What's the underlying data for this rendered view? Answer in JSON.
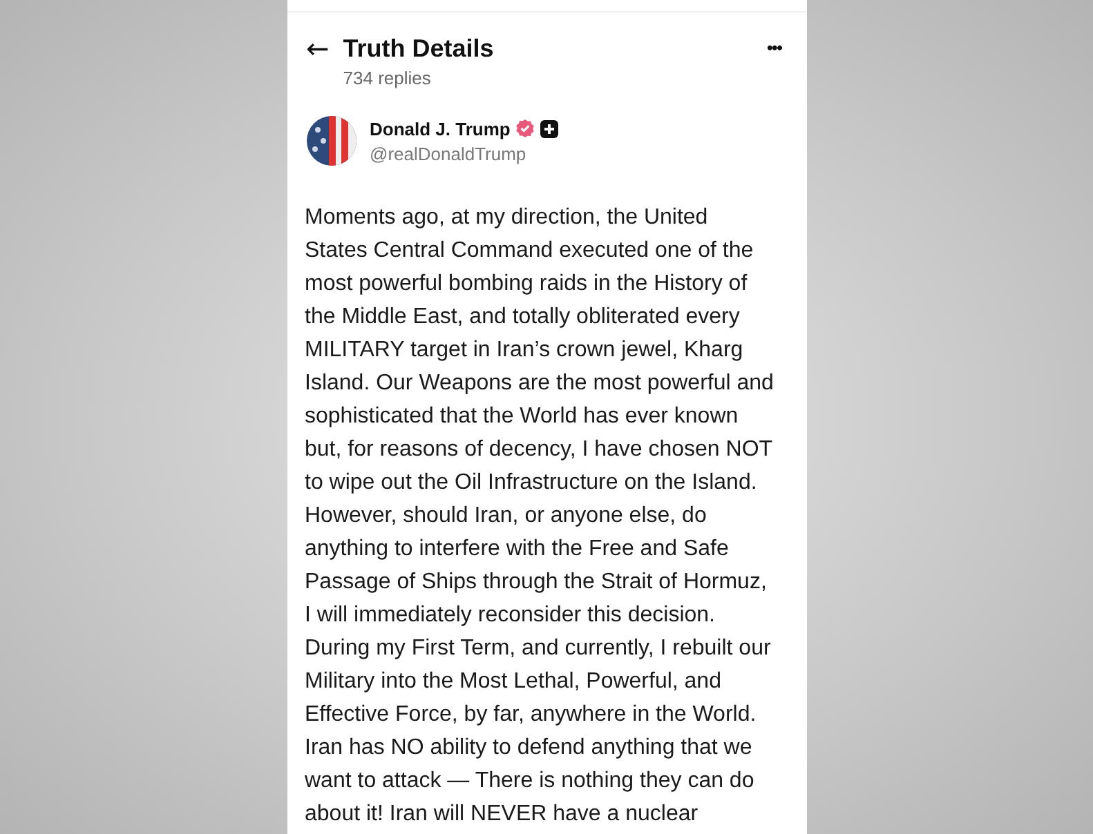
{
  "header": {
    "back_icon": "←",
    "title": "Truth Details",
    "subtitle": "734 replies",
    "more": "•••"
  },
  "author": {
    "name": "Donald J. Trump",
    "handle": "@realDonaldTrump",
    "verified": true
  },
  "post": {
    "lines": [
      "Moments ago, at my direction, the United",
      "States Central Command executed one of the",
      "most powerful bombing raids in the History of",
      "the Middle East, and totally obliterated every",
      "MILITARY target in Iran’s crown jewel, Kharg",
      "Island. Our Weapons are the most powerful and",
      "sophisticated that the World has ever known",
      "but, for reasons of decency, I have chosen NOT",
      "to wipe out the Oil Infrastructure on the Island.",
      "However, should Iran, or anyone else, do",
      "anything to interfere with the Free and Safe",
      "Passage of Ships through the Strait of Hormuz,",
      "I will immediately reconsider this decision.",
      "During my First Term, and currently, I rebuilt our",
      "Military into the Most Lethal, Powerful, and",
      "Effective Force, by far, anywhere in the World.",
      "Iran has NO ability to defend anything that we",
      "want to attack — There is nothing they can do",
      "about it! Iran will NEVER have a nuclear"
    ]
  }
}
